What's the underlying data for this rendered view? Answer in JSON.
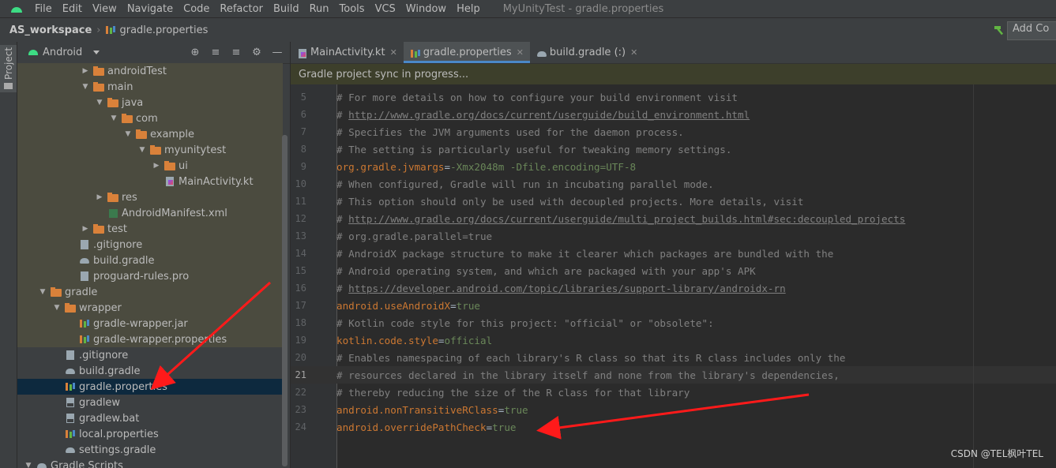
{
  "menubar": {
    "items": [
      "File",
      "Edit",
      "View",
      "Navigate",
      "Code",
      "Refactor",
      "Build",
      "Run",
      "Tools",
      "VCS",
      "Window",
      "Help"
    ],
    "title": "MyUnityTest - gradle.properties"
  },
  "navbar": {
    "workspace": "AS_workspace",
    "file": "gradle.properties",
    "add_config": "Add Co"
  },
  "left_tool": {
    "project_label": "Project"
  },
  "project_panel": {
    "view_label": "Android",
    "tree": [
      {
        "label": "androidTest",
        "icon": "folder",
        "indent": 4,
        "arrow": "right",
        "tint": true
      },
      {
        "label": "main",
        "icon": "folder",
        "indent": 4,
        "arrow": "down",
        "tint": true
      },
      {
        "label": "java",
        "icon": "folder",
        "indent": 5,
        "arrow": "down",
        "tint": true
      },
      {
        "label": "com",
        "icon": "folder",
        "indent": 6,
        "arrow": "down",
        "tint": true
      },
      {
        "label": "example",
        "icon": "folder",
        "indent": 7,
        "arrow": "down",
        "tint": true
      },
      {
        "label": "myunitytest",
        "icon": "folder",
        "indent": 8,
        "arrow": "down",
        "tint": true
      },
      {
        "label": "ui",
        "icon": "folder",
        "indent": 9,
        "arrow": "right",
        "tint": true
      },
      {
        "label": "MainActivity.kt",
        "icon": "kotlin",
        "indent": 9,
        "arrow": "none",
        "tint": true
      },
      {
        "label": "res",
        "icon": "folder",
        "indent": 5,
        "arrow": "right",
        "tint": true
      },
      {
        "label": "AndroidManifest.xml",
        "icon": "xml",
        "indent": 5,
        "arrow": "none",
        "tint": true
      },
      {
        "label": "test",
        "icon": "folder",
        "indent": 4,
        "arrow": "right",
        "tint": true
      },
      {
        "label": ".gitignore",
        "icon": "file",
        "indent": 3,
        "arrow": "none",
        "tint": true
      },
      {
        "label": "build.gradle",
        "icon": "gradle",
        "indent": 3,
        "arrow": "none",
        "tint": true
      },
      {
        "label": "proguard-rules.pro",
        "icon": "file",
        "indent": 3,
        "arrow": "none",
        "tint": true
      },
      {
        "label": "gradle",
        "icon": "folder",
        "indent": 1,
        "arrow": "down",
        "tint": true
      },
      {
        "label": "wrapper",
        "icon": "folder",
        "indent": 2,
        "arrow": "down",
        "tint": true
      },
      {
        "label": "gradle-wrapper.jar",
        "icon": "bars",
        "indent": 3,
        "arrow": "none",
        "tint": true
      },
      {
        "label": "gradle-wrapper.properties",
        "icon": "bars",
        "indent": 3,
        "arrow": "none",
        "tint": true
      },
      {
        "label": ".gitignore",
        "icon": "file",
        "indent": 2,
        "arrow": "none",
        "tint": false
      },
      {
        "label": "build.gradle",
        "icon": "gradle",
        "indent": 2,
        "arrow": "none",
        "tint": false
      },
      {
        "label": "gradle.properties",
        "icon": "bars",
        "indent": 2,
        "arrow": "none",
        "tint": false,
        "selected": true
      },
      {
        "label": "gradlew",
        "icon": "shell",
        "indent": 2,
        "arrow": "none",
        "tint": false
      },
      {
        "label": "gradlew.bat",
        "icon": "shell",
        "indent": 2,
        "arrow": "none",
        "tint": false
      },
      {
        "label": "local.properties",
        "icon": "bars",
        "indent": 2,
        "arrow": "none",
        "tint": false
      },
      {
        "label": "settings.gradle",
        "icon": "gradle",
        "indent": 2,
        "arrow": "none",
        "tint": false
      },
      {
        "label": "Gradle Scripts",
        "icon": "gradle",
        "indent": 0,
        "arrow": "down",
        "tint": false
      }
    ]
  },
  "editor": {
    "tabs": [
      {
        "label": "MainActivity.kt",
        "icon": "kotlin",
        "active": false
      },
      {
        "label": "gradle.properties",
        "icon": "bars",
        "active": true
      },
      {
        "label": "build.gradle (:)",
        "icon": "gradle",
        "active": false
      }
    ],
    "banner": "Gradle project sync in progress...",
    "current_line": 21,
    "lines": [
      {
        "n": "5",
        "kind": "comment",
        "text": "# For more details on how to configure your build environment visit"
      },
      {
        "n": "6",
        "kind": "link",
        "prefix": "# ",
        "text": "http://www.gradle.org/docs/current/userguide/build_environment.html"
      },
      {
        "n": "7",
        "kind": "comment",
        "text": "# Specifies the JVM arguments used for the daemon process."
      },
      {
        "n": "8",
        "kind": "comment",
        "text": "# The setting is particularly useful for tweaking memory settings."
      },
      {
        "n": "9",
        "kind": "prop",
        "key": "org.gradle.jvmargs",
        "value": "-Xmx2048m -Dfile.encoding=UTF-8"
      },
      {
        "n": "10",
        "kind": "comment",
        "text": "# When configured, Gradle will run in incubating parallel mode."
      },
      {
        "n": "11",
        "kind": "comment",
        "text": "# This option should only be used with decoupled projects. More details, visit"
      },
      {
        "n": "12",
        "kind": "link",
        "prefix": "# ",
        "text": "http://www.gradle.org/docs/current/userguide/multi_project_builds.html#sec:decoupled_projects"
      },
      {
        "n": "13",
        "kind": "comment",
        "text": "# org.gradle.parallel=true"
      },
      {
        "n": "14",
        "kind": "comment",
        "text": "# AndroidX package structure to make it clearer which packages are bundled with the"
      },
      {
        "n": "15",
        "kind": "comment",
        "text": "# Android operating system, and which are packaged with your app's APK"
      },
      {
        "n": "16",
        "kind": "link",
        "prefix": "# ",
        "text": "https://developer.android.com/topic/libraries/support-library/androidx-rn"
      },
      {
        "n": "17",
        "kind": "prop",
        "key": "android.useAndroidX",
        "value": "true"
      },
      {
        "n": "18",
        "kind": "comment",
        "text": "# Kotlin code style for this project: \"official\" or \"obsolete\":"
      },
      {
        "n": "19",
        "kind": "prop",
        "key": "kotlin.code.style",
        "value": "official"
      },
      {
        "n": "20",
        "kind": "comment",
        "text": "# Enables namespacing of each library's R class so that its R class includes only the"
      },
      {
        "n": "21",
        "kind": "comment",
        "text": "# resources declared in the library itself and none from the library's dependencies,"
      },
      {
        "n": "22",
        "kind": "comment",
        "text": "# thereby reducing the size of the R class for that library"
      },
      {
        "n": "23",
        "kind": "prop",
        "key": "android.nonTransitiveRClass",
        "value": "true"
      },
      {
        "n": "24",
        "kind": "prop",
        "key": "android.overridePathCheck",
        "value": "true"
      }
    ]
  },
  "watermark": "CSDN @TEL枫叶TEL",
  "colors": {
    "annotation_arrow": "#ff1a1a",
    "folder": "#d9813a",
    "selection": "#0d293e",
    "comment": "#808080",
    "key": "#cc7832",
    "value": "#6a8759"
  }
}
